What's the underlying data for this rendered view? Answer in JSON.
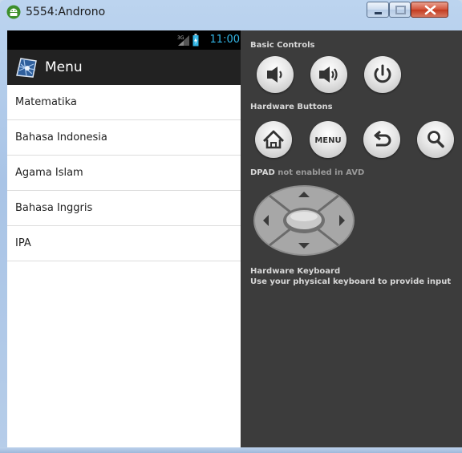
{
  "window": {
    "title": "5554:Androno"
  },
  "status_bar": {
    "signal_label": "3G",
    "time": "11:00"
  },
  "action_bar": {
    "title": "Menu"
  },
  "menu": {
    "items": [
      {
        "label": "Matematika"
      },
      {
        "label": "Bahasa Indonesia"
      },
      {
        "label": "Agama Islam"
      },
      {
        "label": "Bahasa Inggris"
      },
      {
        "label": "IPA"
      }
    ]
  },
  "controls": {
    "basic_label": "Basic Controls",
    "basic_buttons": [
      "volume-down-icon",
      "volume-up-icon",
      "power-icon"
    ],
    "hardware_label": "Hardware Buttons",
    "hardware_buttons": [
      "home-icon",
      "menu-button",
      "back-icon",
      "search-icon"
    ],
    "menu_button_text": "MENU",
    "dpad_label_prefix": "DPAD",
    "dpad_label_suffix": "not enabled in AVD",
    "keyboard_title": "Hardware Keyboard",
    "keyboard_desc": "Use your physical keyboard to provide input"
  },
  "colors": {
    "status_time": "#33b5e5",
    "action_bar": "#222222",
    "panel": "#3c3c3c"
  }
}
